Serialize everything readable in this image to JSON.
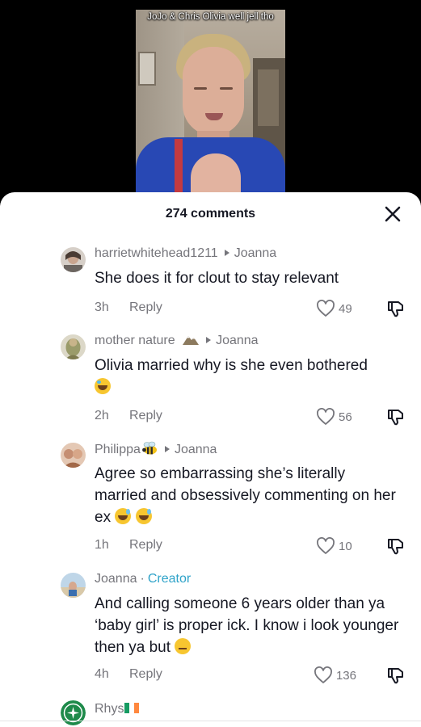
{
  "video": {
    "caption": "JoJo & Chris Olivia well jell tho"
  },
  "sheet": {
    "title": "274 comments"
  },
  "comments": [
    {
      "username": "harrietwhitehead1211",
      "reply_to": "Joanna",
      "text": "She does it for clout to stay relevant",
      "time": "3h",
      "reply_label": "Reply",
      "likes": "49"
    },
    {
      "username": "mother nature",
      "reply_to": "Joanna",
      "text": "Olivia married why is she even bothered",
      "time": "2h",
      "reply_label": "Reply",
      "likes": "56"
    },
    {
      "username": "Philippa",
      "reply_to": "Joanna",
      "text": "Agree so embarrassing she’s literally married and obsessively commenting on her ex",
      "time": "1h",
      "reply_label": "Reply",
      "likes": "10"
    },
    {
      "username": "Joanna",
      "badge": "Creator",
      "text": "And calling someone 6 years older than ya ‘baby girl’ is proper ick. I know i look younger then ya but",
      "time": "4h",
      "reply_label": "Reply",
      "likes": "136"
    },
    {
      "username": "Rhys"
    }
  ],
  "colors": {
    "creator_accent": "#2fa3c9",
    "text_primary": "#161823",
    "text_secondary": "#75757b"
  }
}
